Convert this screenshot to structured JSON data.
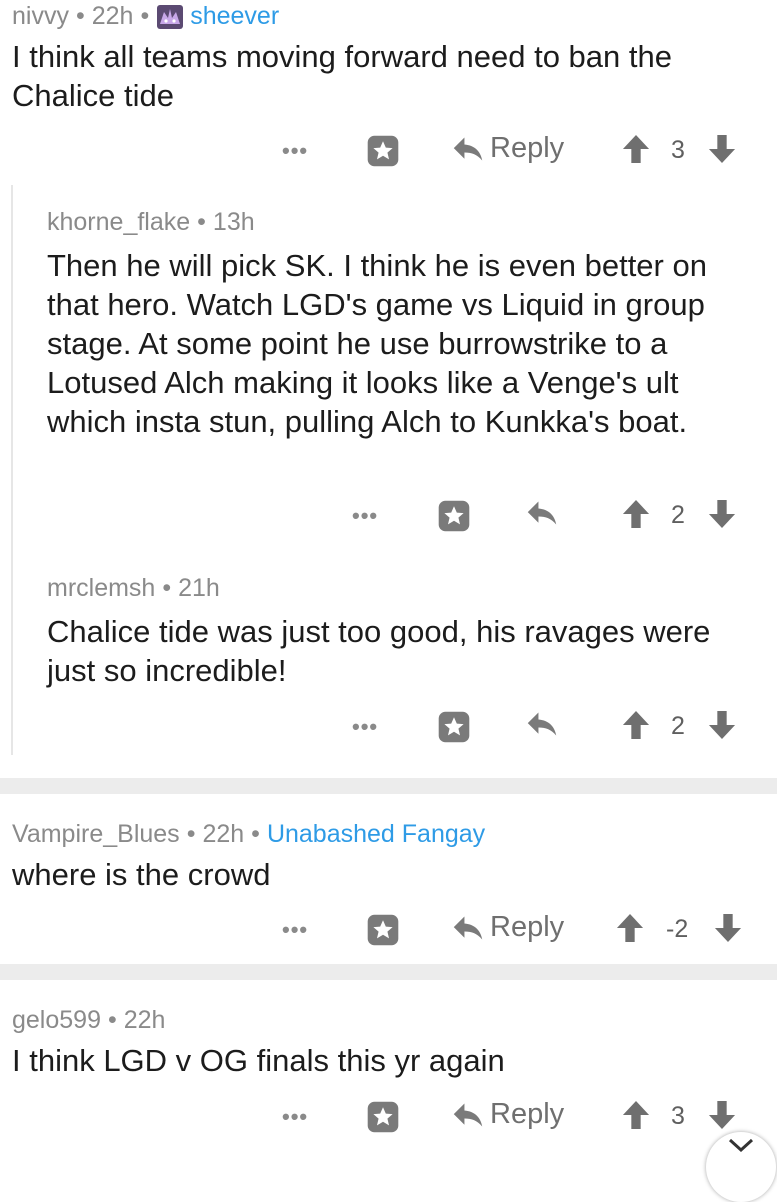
{
  "comments": [
    {
      "author": "nivvy",
      "time": "22h",
      "flair": "sheever",
      "flair_icon": "sheever-flair-icon",
      "body": "I think all teams moving forward need to ban the Chalice tide",
      "reply_label": "Reply",
      "score": "3",
      "replies": [
        {
          "author": "khorne_flake",
          "time": "13h",
          "body": "Then he will pick SK. I think he is even better on that hero. Watch LGD's game vs Liquid in group stage. At some point he use burrowstrike to a Lotused Alch making it looks like a Venge's ult which insta stun, pulling Alch to Kunkka's boat.",
          "score": "2"
        },
        {
          "author": "mrclemsh",
          "time": "21h",
          "body": "Chalice tide was just too good, his ravages were just so incredible!",
          "score": "2"
        }
      ]
    },
    {
      "author": "Vampire_Blues",
      "time": "22h",
      "flair": "Unabashed Fangay",
      "body": "where is the crowd",
      "reply_label": "Reply",
      "score": "-2"
    },
    {
      "author": "gelo599",
      "time": "22h",
      "body": "I think LGD v OG finals this yr again",
      "reply_label": "Reply",
      "score": "3"
    }
  ],
  "more_label": "•••",
  "dot": "•",
  "colors": {
    "flair": "#2e9be6",
    "meta": "#8a8a8a",
    "divider": "#ececec",
    "icon": "#7a7a7a"
  }
}
